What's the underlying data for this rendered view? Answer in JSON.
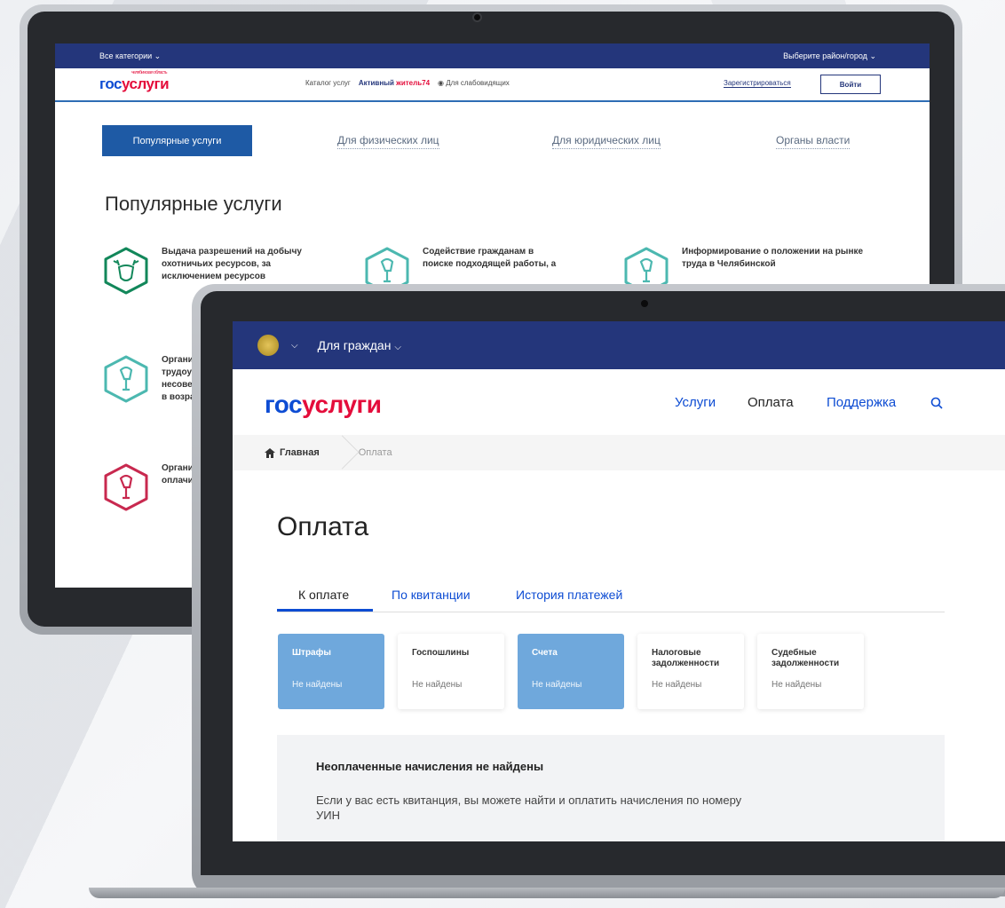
{
  "back_screen": {
    "topbar": {
      "categories": "Все категории",
      "region": "Выберите район/город"
    },
    "logo": {
      "small": "челябинская область",
      "part1": "гос",
      "part2": "услуги"
    },
    "nav": {
      "catalog": "Каталог услуг",
      "active1": "Активный ",
      "active2": "житель74",
      "low_vision": "Для слабовидящих"
    },
    "register": "Зарегистрироваться",
    "login": "Войти",
    "tabs": [
      "Популярные услуги",
      "Для физических лиц",
      "Для юридических лиц",
      "Органы власти"
    ],
    "title": "Популярные услуги",
    "services": [
      {
        "text": "Выдача разрешений на добычу охотничьих ресурсов, за исключением ресурсов"
      },
      {
        "text": "Содействие гражданам в поиске подходящей работы, а"
      },
      {
        "text": "Информирование о положении на рынке труда в Челябинской"
      },
      {
        "text": "Организация трудоустройства несовершеннолетних в возрасте"
      },
      {
        "text": "Организация оплачиваемых работ"
      }
    ]
  },
  "front_screen": {
    "topbar": {
      "citizens": "Для граждан"
    },
    "logo": {
      "part1": "гос",
      "part2": "услуги"
    },
    "nav": {
      "services": "Услуги",
      "payment": "Оплата",
      "support": "Поддержка"
    },
    "breadcrumb": {
      "home": "Главная",
      "current": "Оплата"
    },
    "title": "Оплата",
    "tabs": [
      "К оплате",
      "По квитанции",
      "История платежей"
    ],
    "cards": [
      {
        "title": "Штрафы",
        "status": "Не найдены"
      },
      {
        "title": "Госпошлины",
        "status": "Не найдены"
      },
      {
        "title": "Счета",
        "status": "Не найдены"
      },
      {
        "title": "Налоговые задолженности",
        "status": "Не найдены"
      },
      {
        "title": "Судебные задолженности",
        "status": "Не найдены"
      }
    ],
    "info": {
      "heading": "Неоплаченные начисления не найдены",
      "text": "Если у вас есть квитанция, вы можете найти и оплатить начисления по номеру УИН"
    }
  },
  "colors": {
    "brand_blue": "#0d4cd3",
    "brand_red": "#e40d3b",
    "topbar": "#24367b",
    "card_blue": "#6fa8dc"
  },
  "icons": [
    "deer-icon",
    "shovel-icon",
    "eye-icon",
    "search-icon",
    "home-icon",
    "chevron-down-icon",
    "emblem-icon"
  ]
}
